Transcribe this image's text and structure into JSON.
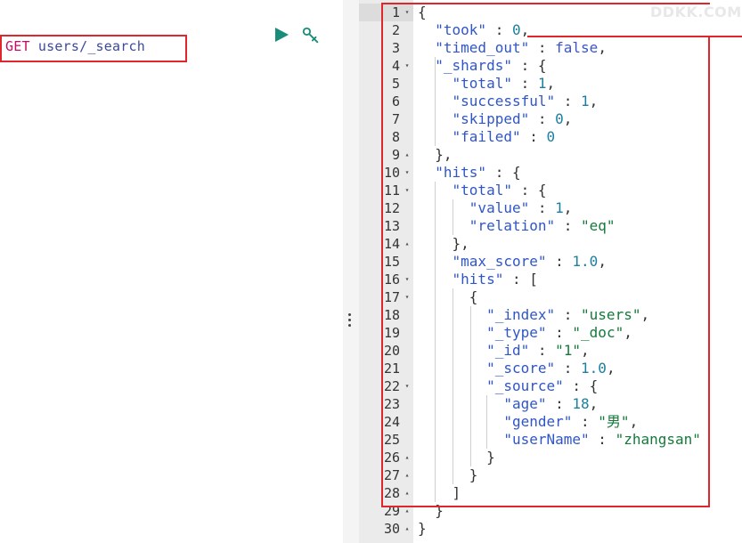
{
  "request": {
    "method": "GET",
    "path": " users/_search"
  },
  "toolbar": {
    "run_icon": "play-icon",
    "settings_icon": "wrench-icon",
    "accent": "#1a8c7a"
  },
  "watermark": "DDKK.COM",
  "response_lines": [
    {
      "n": "1",
      "fold": "▾",
      "parts": [
        [
          "p",
          "{"
        ]
      ]
    },
    {
      "n": "2",
      "fold": "",
      "parts": [
        [
          "p",
          "  "
        ],
        [
          "k",
          "\"took\""
        ],
        [
          "p",
          " : "
        ],
        [
          "n",
          "0"
        ],
        [
          "p",
          ","
        ]
      ]
    },
    {
      "n": "3",
      "fold": "",
      "parts": [
        [
          "p",
          "  "
        ],
        [
          "k",
          "\"timed_out\""
        ],
        [
          "p",
          " : "
        ],
        [
          "b",
          "false"
        ],
        [
          "p",
          ","
        ]
      ]
    },
    {
      "n": "4",
      "fold": "▾",
      "parts": [
        [
          "p",
          "  "
        ],
        [
          "k",
          "\"_shards\""
        ],
        [
          "p",
          " : {"
        ]
      ]
    },
    {
      "n": "5",
      "fold": "",
      "parts": [
        [
          "p",
          "    "
        ],
        [
          "k",
          "\"total\""
        ],
        [
          "p",
          " : "
        ],
        [
          "n",
          "1"
        ],
        [
          "p",
          ","
        ]
      ]
    },
    {
      "n": "6",
      "fold": "",
      "parts": [
        [
          "p",
          "    "
        ],
        [
          "k",
          "\"successful\""
        ],
        [
          "p",
          " : "
        ],
        [
          "n",
          "1"
        ],
        [
          "p",
          ","
        ]
      ]
    },
    {
      "n": "7",
      "fold": "",
      "parts": [
        [
          "p",
          "    "
        ],
        [
          "k",
          "\"skipped\""
        ],
        [
          "p",
          " : "
        ],
        [
          "n",
          "0"
        ],
        [
          "p",
          ","
        ]
      ]
    },
    {
      "n": "8",
      "fold": "",
      "parts": [
        [
          "p",
          "    "
        ],
        [
          "k",
          "\"failed\""
        ],
        [
          "p",
          " : "
        ],
        [
          "n",
          "0"
        ]
      ]
    },
    {
      "n": "9",
      "fold": "▴",
      "parts": [
        [
          "p",
          "  },"
        ]
      ]
    },
    {
      "n": "10",
      "fold": "▾",
      "parts": [
        [
          "p",
          "  "
        ],
        [
          "k",
          "\"hits\""
        ],
        [
          "p",
          " : {"
        ]
      ]
    },
    {
      "n": "11",
      "fold": "▾",
      "parts": [
        [
          "p",
          "    "
        ],
        [
          "k",
          "\"total\""
        ],
        [
          "p",
          " : {"
        ]
      ]
    },
    {
      "n": "12",
      "fold": "",
      "parts": [
        [
          "p",
          "      "
        ],
        [
          "k",
          "\"value\""
        ],
        [
          "p",
          " : "
        ],
        [
          "n",
          "1"
        ],
        [
          "p",
          ","
        ]
      ]
    },
    {
      "n": "13",
      "fold": "",
      "parts": [
        [
          "p",
          "      "
        ],
        [
          "k",
          "\"relation\""
        ],
        [
          "p",
          " : "
        ],
        [
          "s",
          "\"eq\""
        ]
      ]
    },
    {
      "n": "14",
      "fold": "▴",
      "parts": [
        [
          "p",
          "    },"
        ]
      ]
    },
    {
      "n": "15",
      "fold": "",
      "parts": [
        [
          "p",
          "    "
        ],
        [
          "k",
          "\"max_score\""
        ],
        [
          "p",
          " : "
        ],
        [
          "n",
          "1.0"
        ],
        [
          "p",
          ","
        ]
      ]
    },
    {
      "n": "16",
      "fold": "▾",
      "parts": [
        [
          "p",
          "    "
        ],
        [
          "k",
          "\"hits\""
        ],
        [
          "p",
          " : ["
        ]
      ]
    },
    {
      "n": "17",
      "fold": "▾",
      "parts": [
        [
          "p",
          "      {"
        ]
      ]
    },
    {
      "n": "18",
      "fold": "",
      "parts": [
        [
          "p",
          "        "
        ],
        [
          "k",
          "\"_index\""
        ],
        [
          "p",
          " : "
        ],
        [
          "s",
          "\"users\""
        ],
        [
          "p",
          ","
        ]
      ]
    },
    {
      "n": "19",
      "fold": "",
      "parts": [
        [
          "p",
          "        "
        ],
        [
          "k",
          "\"_type\""
        ],
        [
          "p",
          " : "
        ],
        [
          "s",
          "\"_doc\""
        ],
        [
          "p",
          ","
        ]
      ]
    },
    {
      "n": "20",
      "fold": "",
      "parts": [
        [
          "p",
          "        "
        ],
        [
          "k",
          "\"_id\""
        ],
        [
          "p",
          " : "
        ],
        [
          "s",
          "\"1\""
        ],
        [
          "p",
          ","
        ]
      ]
    },
    {
      "n": "21",
      "fold": "",
      "parts": [
        [
          "p",
          "        "
        ],
        [
          "k",
          "\"_score\""
        ],
        [
          "p",
          " : "
        ],
        [
          "n",
          "1.0"
        ],
        [
          "p",
          ","
        ]
      ]
    },
    {
      "n": "22",
      "fold": "▾",
      "parts": [
        [
          "p",
          "        "
        ],
        [
          "k",
          "\"_source\""
        ],
        [
          "p",
          " : {"
        ]
      ]
    },
    {
      "n": "23",
      "fold": "",
      "parts": [
        [
          "p",
          "          "
        ],
        [
          "k",
          "\"age\""
        ],
        [
          "p",
          " : "
        ],
        [
          "n",
          "18"
        ],
        [
          "p",
          ","
        ]
      ]
    },
    {
      "n": "24",
      "fold": "",
      "parts": [
        [
          "p",
          "          "
        ],
        [
          "k",
          "\"gender\""
        ],
        [
          "p",
          " : "
        ],
        [
          "s",
          "\"男\""
        ],
        [
          "p",
          ","
        ]
      ]
    },
    {
      "n": "25",
      "fold": "",
      "parts": [
        [
          "p",
          "          "
        ],
        [
          "k",
          "\"userName\""
        ],
        [
          "p",
          " : "
        ],
        [
          "s",
          "\"zhangsan\""
        ]
      ]
    },
    {
      "n": "26",
      "fold": "▴",
      "parts": [
        [
          "p",
          "        }"
        ]
      ]
    },
    {
      "n": "27",
      "fold": "▴",
      "parts": [
        [
          "p",
          "      }"
        ]
      ]
    },
    {
      "n": "28",
      "fold": "▴",
      "parts": [
        [
          "p",
          "    ]"
        ]
      ]
    },
    {
      "n": "29",
      "fold": "▴",
      "parts": [
        [
          "p",
          "  }"
        ]
      ]
    },
    {
      "n": "30",
      "fold": "▴",
      "parts": [
        [
          "p",
          "}"
        ]
      ]
    }
  ]
}
